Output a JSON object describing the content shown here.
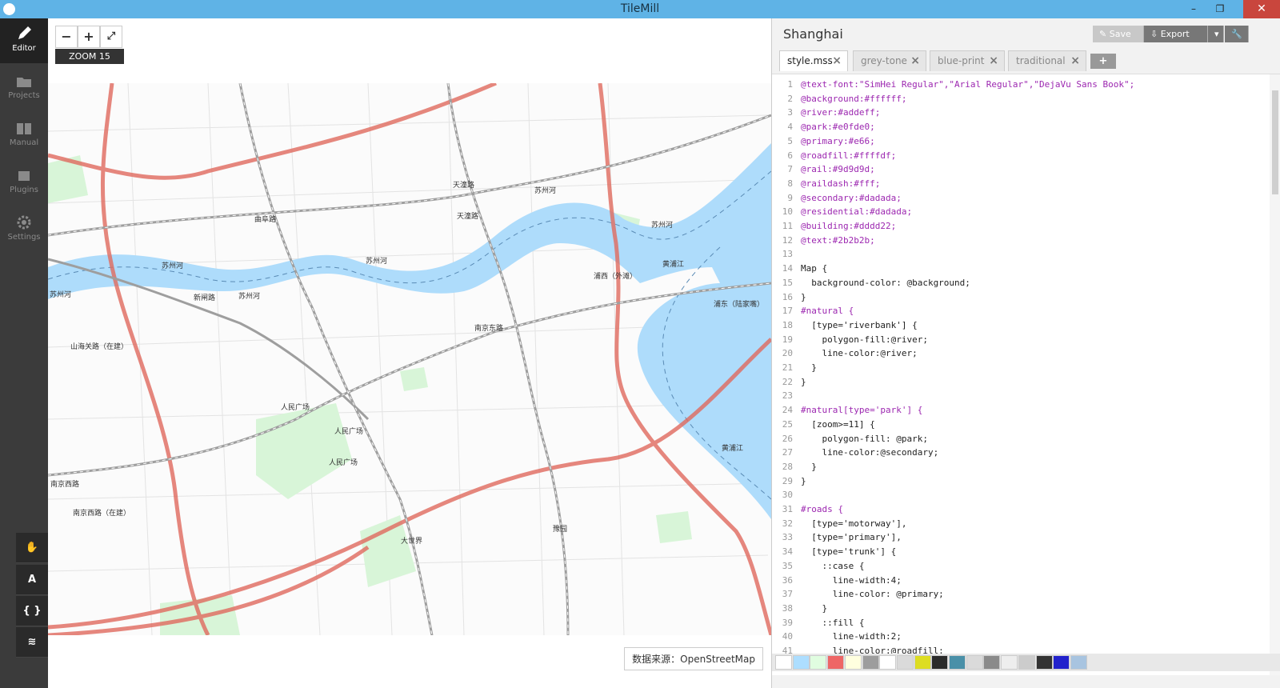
{
  "window": {
    "title": "TileMill",
    "minimize": "–",
    "restore": "❐",
    "close": "✕"
  },
  "sidebar": {
    "items": [
      {
        "label": "Editor",
        "icon": "pencil-icon"
      },
      {
        "label": "Projects",
        "icon": "folder-icon"
      },
      {
        "label": "Manual",
        "icon": "book-icon"
      },
      {
        "label": "Plugins",
        "icon": "plug-icon"
      },
      {
        "label": "Settings",
        "icon": "gear-icon"
      }
    ],
    "tools": [
      {
        "label": "✋",
        "icon": "hand-icon"
      },
      {
        "label": "A",
        "icon": "text-icon"
      },
      {
        "label": "{ }",
        "icon": "braces-icon"
      },
      {
        "label": "≋",
        "icon": "layers-icon"
      }
    ]
  },
  "map": {
    "zoom_out": "−",
    "zoom_in": "+",
    "fullscreen": "⤢",
    "zoom_label": "ZOOM 15",
    "attribution": "数据来源：OpenStreetMap",
    "labels": [
      "天潼路",
      "天潼路",
      "曲阜路",
      "苏州河",
      "苏州河",
      "苏州河",
      "苏州河",
      "苏州河",
      "苏州河",
      "黄浦江",
      "黄浦江",
      "新闸路",
      "浦西（外滩）",
      "浦东（陆家嘴）",
      "南京东路",
      "山海关路（在建）",
      "人民广场",
      "人民广场",
      "人民广场",
      "南京西路",
      "南京西路（在建）",
      "大世界",
      "豫园"
    ]
  },
  "editor": {
    "project": "Shanghai",
    "save": "Save",
    "export": "Export",
    "tabs": [
      "style.mss",
      "grey-tone",
      "blue-print",
      "traditional"
    ],
    "add_tab": "+",
    "lines": [
      "@text-font:\"SimHei Regular\",\"Arial Regular\",\"DejaVu Sans Book\";",
      "@background:#ffffff;",
      "@river:#addeff;",
      "@park:#e0fde0;",
      "@primary:#e66;",
      "@roadfill:#ffffdf;",
      "@rail:#9d9d9d;",
      "@raildash:#fff;",
      "@secondary:#dadada;",
      "@residential:#dadada;",
      "@building:#dddd22;",
      "@text:#2b2b2b;",
      "",
      "Map {",
      "  background-color: @background;",
      "}",
      "#natural {",
      "  [type='riverbank'] {",
      "    polygon-fill:@river;",
      "    line-color:@river;",
      "  }",
      "}",
      "",
      "#natural[type='park'] {",
      "  [zoom>=11] {",
      "    polygon-fill: @park;",
      "    line-color:@secondary;",
      "  }",
      "}",
      "",
      "#roads {",
      "  [type='motorway'],",
      "  [type='primary'],",
      "  [type='trunk'] {",
      "    ::case {",
      "      line-width:4;",
      "      line-color: @primary;",
      "    }",
      "    ::fill {",
      "      line-width:2;",
      "      line-color:@roadfill;"
    ]
  },
  "palette": [
    "#ffffff",
    "#addeff",
    "#e0fde0",
    "#ee6666",
    "#ffffdf",
    "#9d9d9d",
    "#ffffff",
    "#dadada",
    "#dddd22",
    "#2b2b2b",
    "#4a90a8",
    "#dadada",
    "#8a8a8a",
    "#eeeeee",
    "#cccccc",
    "#333333",
    "#2222cc",
    "#a8c4e0"
  ]
}
